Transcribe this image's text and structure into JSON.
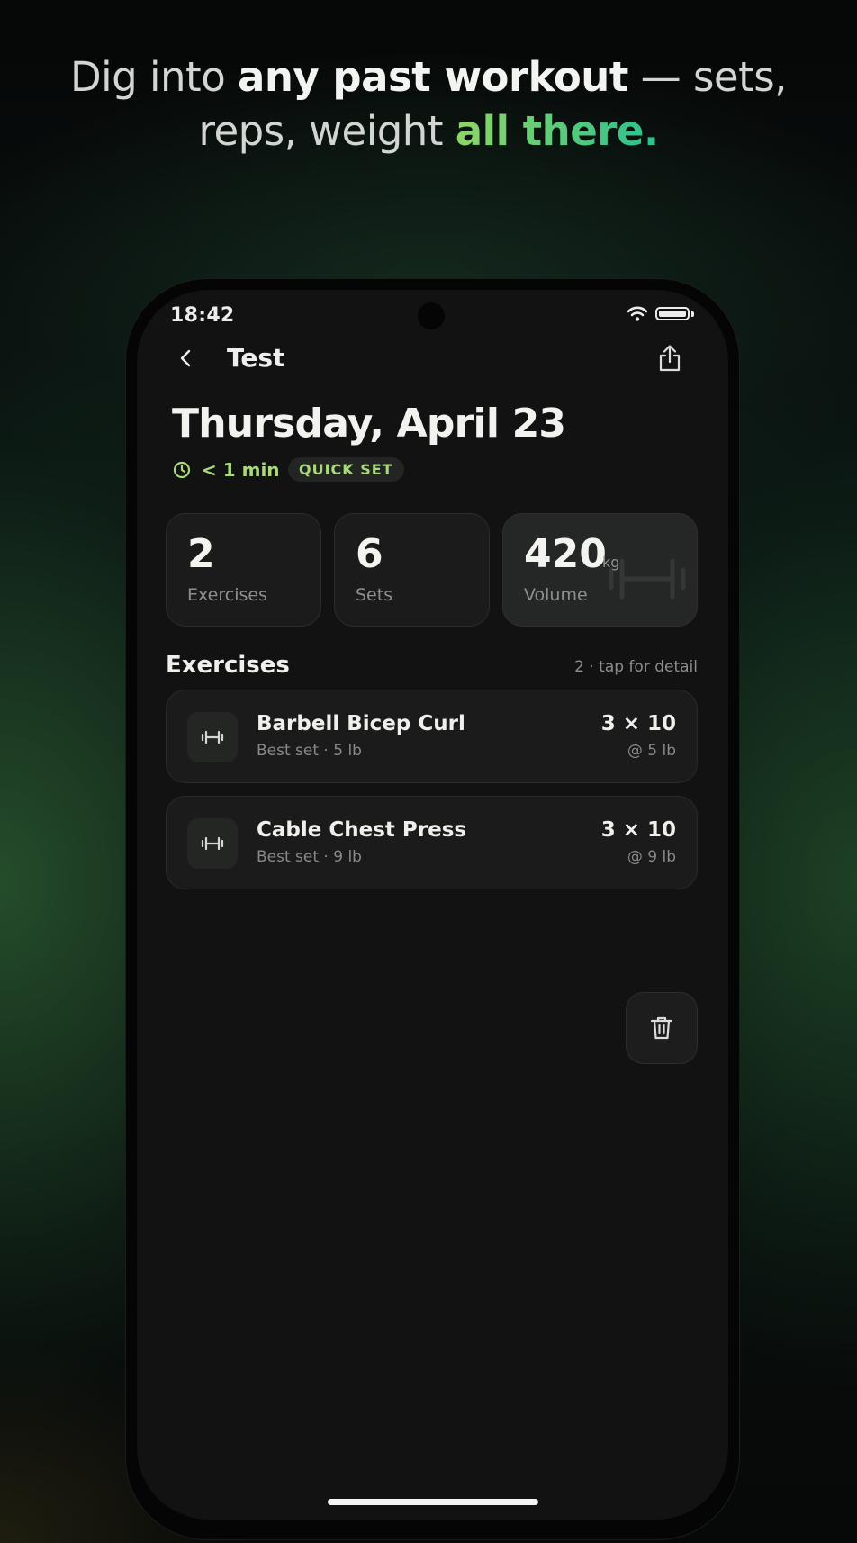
{
  "headline": {
    "part1": "Dig into ",
    "bold": "any past workout",
    "part2": " — sets,",
    "part3": "reps, weight ",
    "accent": "all there."
  },
  "status_bar": {
    "time": "18:42",
    "icons": [
      "wifi-icon",
      "battery-icon"
    ]
  },
  "nav": {
    "title": "Test",
    "back_icon": "chevron-left-icon",
    "share_icon": "share-icon"
  },
  "workout": {
    "date": "Thursday, April 23",
    "duration": "< 1 min",
    "badge": "QUICK SET",
    "accent_color": "#a9d97b"
  },
  "stats": [
    {
      "value": "2",
      "label": "Exercises"
    },
    {
      "value": "6",
      "label": "Sets"
    },
    {
      "value": "420",
      "unit": "kg",
      "label": "Volume"
    }
  ],
  "exercises_section": {
    "title": "Exercises",
    "meta": "2 · tap for detail",
    "items": [
      {
        "name": "Barbell Bicep Curl",
        "best": "Best set · 5 lb",
        "sets": "3 × 10",
        "weight": "@ 5 lb",
        "icon": "dumbbell-icon"
      },
      {
        "name": "Cable Chest Press",
        "best": "Best set · 9 lb",
        "sets": "3 × 10",
        "weight": "@ 9 lb",
        "icon": "dumbbell-icon"
      }
    ]
  },
  "actions": {
    "delete_icon": "trash-icon"
  }
}
